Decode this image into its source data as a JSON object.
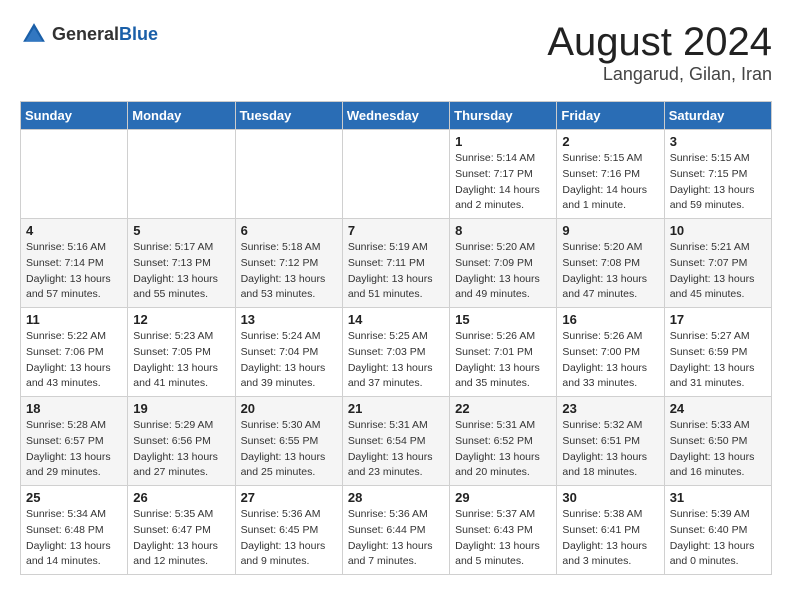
{
  "logo": {
    "text_general": "General",
    "text_blue": "Blue"
  },
  "title": {
    "month_year": "August 2024",
    "location": "Langarud, Gilan, Iran"
  },
  "days_of_week": [
    "Sunday",
    "Monday",
    "Tuesday",
    "Wednesday",
    "Thursday",
    "Friday",
    "Saturday"
  ],
  "weeks": [
    [
      {
        "day": "",
        "info": ""
      },
      {
        "day": "",
        "info": ""
      },
      {
        "day": "",
        "info": ""
      },
      {
        "day": "",
        "info": ""
      },
      {
        "day": "1",
        "info": "Sunrise: 5:14 AM\nSunset: 7:17 PM\nDaylight: 14 hours\nand 2 minutes."
      },
      {
        "day": "2",
        "info": "Sunrise: 5:15 AM\nSunset: 7:16 PM\nDaylight: 14 hours\nand 1 minute."
      },
      {
        "day": "3",
        "info": "Sunrise: 5:15 AM\nSunset: 7:15 PM\nDaylight: 13 hours\nand 59 minutes."
      }
    ],
    [
      {
        "day": "4",
        "info": "Sunrise: 5:16 AM\nSunset: 7:14 PM\nDaylight: 13 hours\nand 57 minutes."
      },
      {
        "day": "5",
        "info": "Sunrise: 5:17 AM\nSunset: 7:13 PM\nDaylight: 13 hours\nand 55 minutes."
      },
      {
        "day": "6",
        "info": "Sunrise: 5:18 AM\nSunset: 7:12 PM\nDaylight: 13 hours\nand 53 minutes."
      },
      {
        "day": "7",
        "info": "Sunrise: 5:19 AM\nSunset: 7:11 PM\nDaylight: 13 hours\nand 51 minutes."
      },
      {
        "day": "8",
        "info": "Sunrise: 5:20 AM\nSunset: 7:09 PM\nDaylight: 13 hours\nand 49 minutes."
      },
      {
        "day": "9",
        "info": "Sunrise: 5:20 AM\nSunset: 7:08 PM\nDaylight: 13 hours\nand 47 minutes."
      },
      {
        "day": "10",
        "info": "Sunrise: 5:21 AM\nSunset: 7:07 PM\nDaylight: 13 hours\nand 45 minutes."
      }
    ],
    [
      {
        "day": "11",
        "info": "Sunrise: 5:22 AM\nSunset: 7:06 PM\nDaylight: 13 hours\nand 43 minutes."
      },
      {
        "day": "12",
        "info": "Sunrise: 5:23 AM\nSunset: 7:05 PM\nDaylight: 13 hours\nand 41 minutes."
      },
      {
        "day": "13",
        "info": "Sunrise: 5:24 AM\nSunset: 7:04 PM\nDaylight: 13 hours\nand 39 minutes."
      },
      {
        "day": "14",
        "info": "Sunrise: 5:25 AM\nSunset: 7:03 PM\nDaylight: 13 hours\nand 37 minutes."
      },
      {
        "day": "15",
        "info": "Sunrise: 5:26 AM\nSunset: 7:01 PM\nDaylight: 13 hours\nand 35 minutes."
      },
      {
        "day": "16",
        "info": "Sunrise: 5:26 AM\nSunset: 7:00 PM\nDaylight: 13 hours\nand 33 minutes."
      },
      {
        "day": "17",
        "info": "Sunrise: 5:27 AM\nSunset: 6:59 PM\nDaylight: 13 hours\nand 31 minutes."
      }
    ],
    [
      {
        "day": "18",
        "info": "Sunrise: 5:28 AM\nSunset: 6:57 PM\nDaylight: 13 hours\nand 29 minutes."
      },
      {
        "day": "19",
        "info": "Sunrise: 5:29 AM\nSunset: 6:56 PM\nDaylight: 13 hours\nand 27 minutes."
      },
      {
        "day": "20",
        "info": "Sunrise: 5:30 AM\nSunset: 6:55 PM\nDaylight: 13 hours\nand 25 minutes."
      },
      {
        "day": "21",
        "info": "Sunrise: 5:31 AM\nSunset: 6:54 PM\nDaylight: 13 hours\nand 23 minutes."
      },
      {
        "day": "22",
        "info": "Sunrise: 5:31 AM\nSunset: 6:52 PM\nDaylight: 13 hours\nand 20 minutes."
      },
      {
        "day": "23",
        "info": "Sunrise: 5:32 AM\nSunset: 6:51 PM\nDaylight: 13 hours\nand 18 minutes."
      },
      {
        "day": "24",
        "info": "Sunrise: 5:33 AM\nSunset: 6:50 PM\nDaylight: 13 hours\nand 16 minutes."
      }
    ],
    [
      {
        "day": "25",
        "info": "Sunrise: 5:34 AM\nSunset: 6:48 PM\nDaylight: 13 hours\nand 14 minutes."
      },
      {
        "day": "26",
        "info": "Sunrise: 5:35 AM\nSunset: 6:47 PM\nDaylight: 13 hours\nand 12 minutes."
      },
      {
        "day": "27",
        "info": "Sunrise: 5:36 AM\nSunset: 6:45 PM\nDaylight: 13 hours\nand 9 minutes."
      },
      {
        "day": "28",
        "info": "Sunrise: 5:36 AM\nSunset: 6:44 PM\nDaylight: 13 hours\nand 7 minutes."
      },
      {
        "day": "29",
        "info": "Sunrise: 5:37 AM\nSunset: 6:43 PM\nDaylight: 13 hours\nand 5 minutes."
      },
      {
        "day": "30",
        "info": "Sunrise: 5:38 AM\nSunset: 6:41 PM\nDaylight: 13 hours\nand 3 minutes."
      },
      {
        "day": "31",
        "info": "Sunrise: 5:39 AM\nSunset: 6:40 PM\nDaylight: 13 hours\nand 0 minutes."
      }
    ]
  ]
}
